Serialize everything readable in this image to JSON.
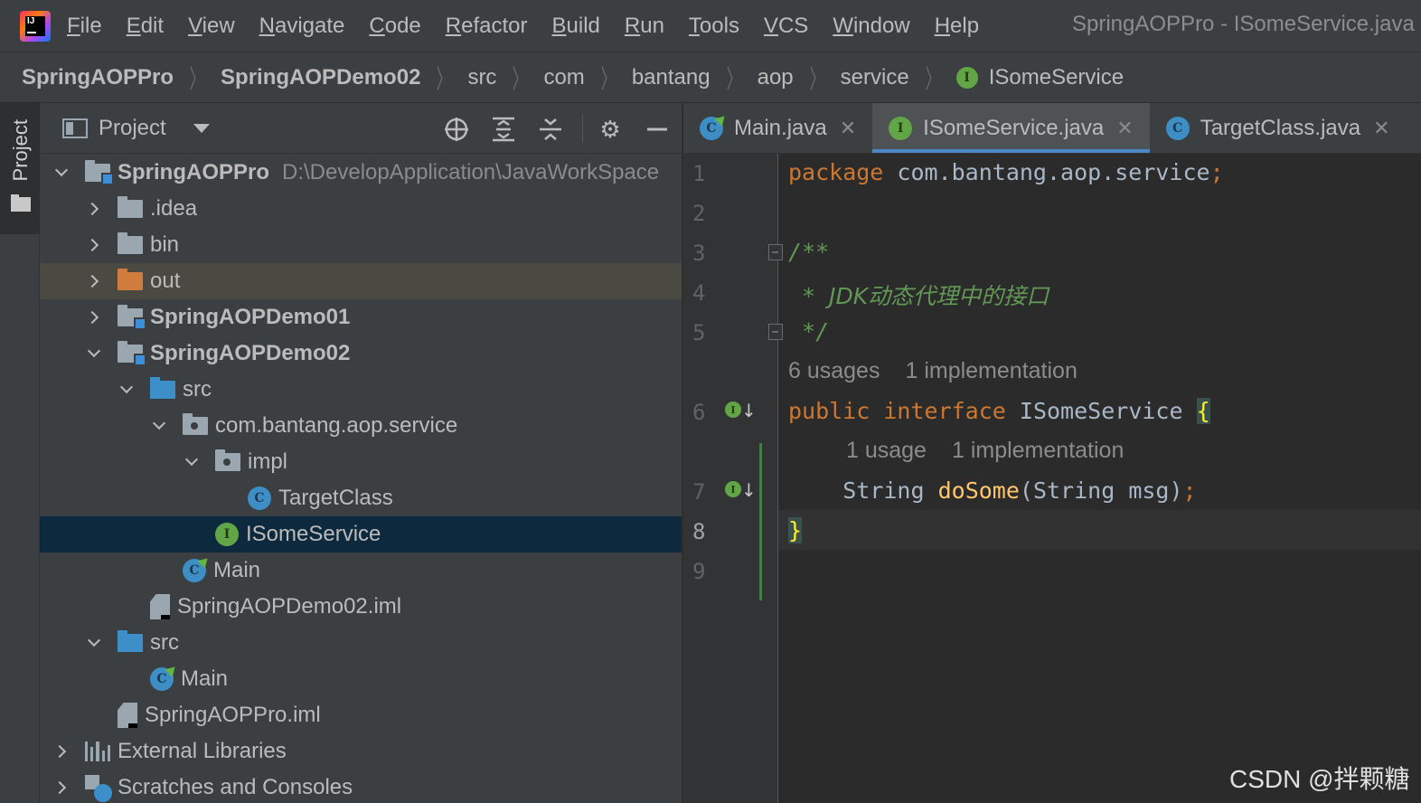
{
  "menubar": {
    "items": [
      "File",
      "Edit",
      "View",
      "Navigate",
      "Code",
      "Refactor",
      "Build",
      "Run",
      "Tools",
      "VCS",
      "Window",
      "Help"
    ],
    "window_title": "SpringAOPPro - ISomeService.java"
  },
  "breadcrumb": {
    "items": [
      "SpringAOPPro",
      "SpringAOPDemo02",
      "src",
      "com",
      "bantang",
      "aop",
      "service",
      "ISomeService"
    ]
  },
  "toolstrip": {
    "project_label": "Project"
  },
  "project_panel": {
    "title": "Project",
    "tree": [
      {
        "label": "SpringAOPPro",
        "path": "D:\\DevelopApplication\\JavaWorkSpace"
      },
      {
        "label": ".idea"
      },
      {
        "label": "bin"
      },
      {
        "label": "out"
      },
      {
        "label": "SpringAOPDemo01"
      },
      {
        "label": "SpringAOPDemo02"
      },
      {
        "label": "src"
      },
      {
        "label": "com.bantang.aop.service"
      },
      {
        "label": "impl"
      },
      {
        "label": "TargetClass"
      },
      {
        "label": "ISomeService"
      },
      {
        "label": "Main"
      },
      {
        "label": "SpringAOPDemo02.iml"
      },
      {
        "label": "src"
      },
      {
        "label": "Main"
      },
      {
        "label": "SpringAOPPro.iml"
      },
      {
        "label": "External Libraries"
      },
      {
        "label": "Scratches and Consoles"
      }
    ]
  },
  "editor": {
    "tabs": [
      {
        "label": "Main.java",
        "active": false
      },
      {
        "label": "ISomeService.java",
        "active": true
      },
      {
        "label": "TargetClass.java",
        "active": false
      }
    ],
    "line_numbers": [
      "1",
      "2",
      "3",
      "4",
      "5",
      "6",
      "7",
      "8",
      "9"
    ],
    "code": {
      "l1_kw": "package",
      "l1_rest": " com.bantang.aop.service",
      "l1_semi": ";",
      "l3": "/**",
      "l4_star": " * ",
      "l4_text": "JDK动态代理中的接口",
      "l5": " */",
      "l6_kw1": "public",
      "l6_kw2": "interface",
      "l6_name": "ISomeService",
      "l6_brace": "{",
      "l7_type": "String",
      "l7_fn": "doSome",
      "l7_params": "(String msg)",
      "l7_semi": ";",
      "l8_brace": "}"
    },
    "inlay_hints": {
      "interface_usages": "6 usages",
      "interface_impl": "1 implementation",
      "method_usages": "1 usage",
      "method_impl": "1 implementation"
    }
  },
  "watermark": "CSDN @拌颗糖",
  "colors": {
    "background": "#2b2b2b",
    "panel": "#3c3f41",
    "selection": "#0d293e",
    "keyword": "#cc7832",
    "comment": "#629755",
    "function": "#ffc66d",
    "interface_green": "#62a547",
    "class_blue": "#3c8ec5"
  }
}
